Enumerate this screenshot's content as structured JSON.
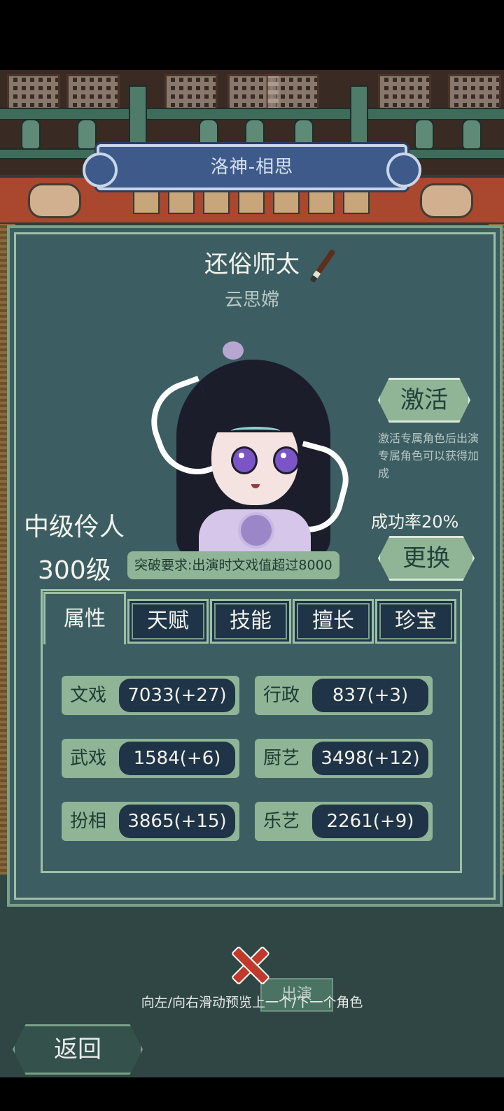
{
  "banner": {
    "title": "洛神-相思"
  },
  "character": {
    "title": "还俗师太",
    "name": "云思嫦",
    "rank": "中级伶人",
    "level": "300级",
    "requirement": "突破要求:出演时文戏值超过8000"
  },
  "activate": {
    "label": "激活",
    "note": "激活专属角色后出演专属角色可以获得加成"
  },
  "success_rate": "成功率20%",
  "change": {
    "label": "更换"
  },
  "tabs": [
    {
      "label": "属性",
      "active": true
    },
    {
      "label": "天赋",
      "active": false
    },
    {
      "label": "技能",
      "active": false
    },
    {
      "label": "擅长",
      "active": false
    },
    {
      "label": "珍宝",
      "active": false
    }
  ],
  "stats": [
    {
      "label": "文戏",
      "value": "7033(+27)"
    },
    {
      "label": "行政",
      "value": "837(+3)"
    },
    {
      "label": "武戏",
      "value": "1584(+6)"
    },
    {
      "label": "厨艺",
      "value": "3498(+12)"
    },
    {
      "label": "扮相",
      "value": "3865(+15)"
    },
    {
      "label": "乐艺",
      "value": "2261(+9)"
    }
  ],
  "perform": {
    "label": "出演"
  },
  "hint": "向左/向右滑动预览上一个/下一个角色",
  "back": {
    "label": "返回"
  },
  "icons": [
    "brush-icon",
    "close-icon"
  ],
  "colors": {
    "jade": "#8fb596",
    "panel": "#3c5e62",
    "dark": "#1f3446",
    "banner": "#3d5a8a"
  }
}
